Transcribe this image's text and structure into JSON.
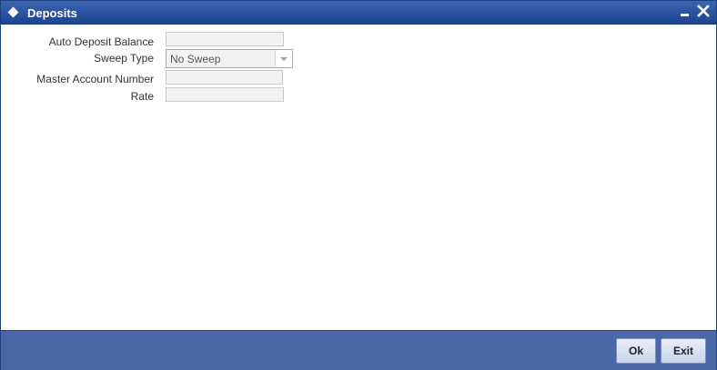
{
  "window": {
    "title": "Deposits",
    "accent_color": "#2a529e",
    "footer_color": "#4a67a8",
    "icons": [
      "diamond-icon",
      "minimize-icon",
      "close-icon"
    ]
  },
  "form": {
    "auto_deposit_balance": {
      "label": "Auto Deposit Balance",
      "value": ""
    },
    "sweep_type": {
      "label": "Sweep Type",
      "value": "No Sweep"
    },
    "master_account_number": {
      "label": "Master Account Number",
      "value": ""
    },
    "rate": {
      "label": "Rate",
      "value": ""
    }
  },
  "footer": {
    "ok_label": "Ok",
    "exit_label": "Exit"
  }
}
